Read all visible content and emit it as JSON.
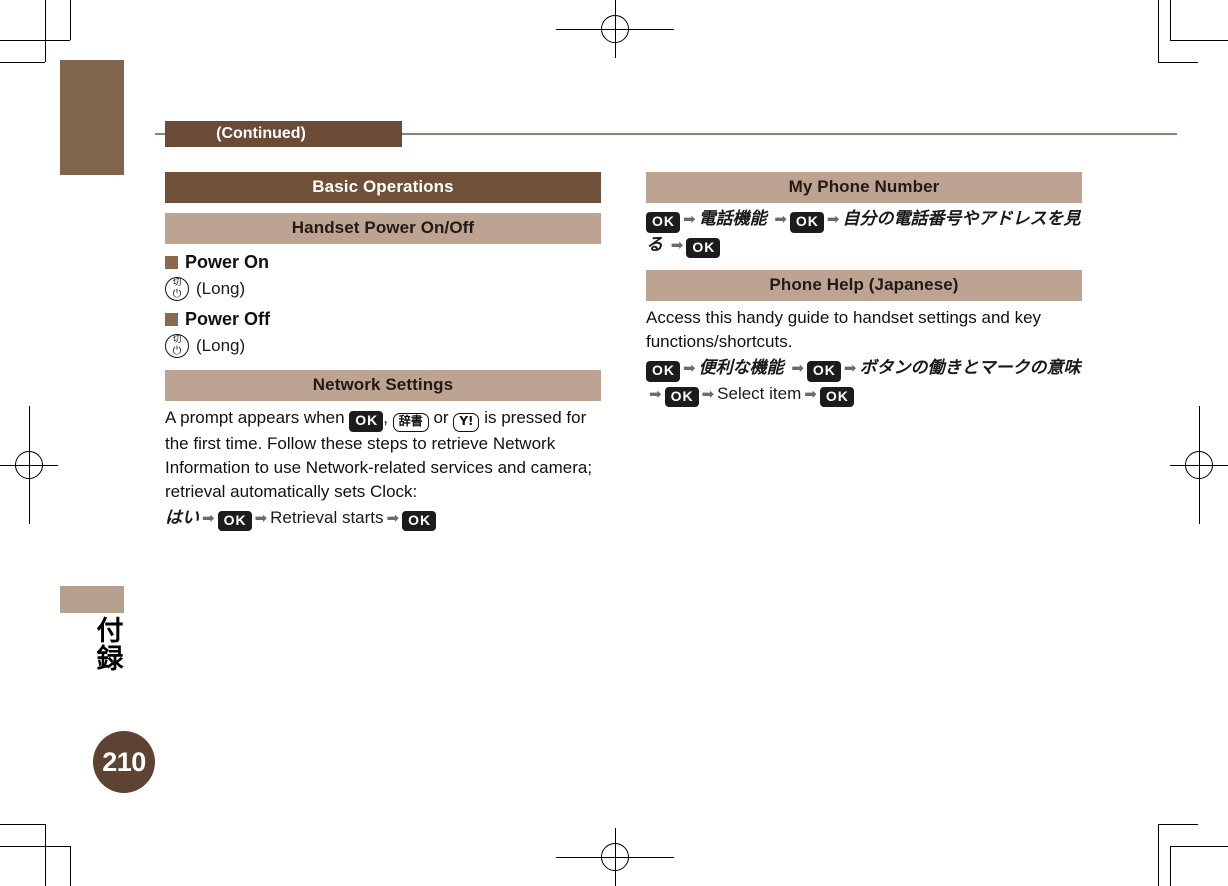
{
  "page": {
    "continued_label": "(Continued)",
    "page_number": "210",
    "side_tab_label": "付録"
  },
  "colors": {
    "bar_major": "#6F5038",
    "bar_minor": "#BCA392",
    "tab": "#80644C",
    "page_badge": "#5E4232",
    "rule": "#9A7F6A"
  },
  "icons": {
    "ok_key": "OK",
    "dictionary_key": "辞書",
    "yahoo_key": "Y!",
    "power_key_top": "切",
    "power_key_bottom": "⏻",
    "arrow": "➡"
  },
  "left_column": {
    "section_title": "Basic Operations",
    "blocks": [
      {
        "heading": "Handset Power On/Off",
        "subsections": [
          {
            "label": "Power On",
            "action": "(Long)"
          },
          {
            "label": "Power Off",
            "action": "(Long)"
          }
        ]
      },
      {
        "heading": "Network Settings",
        "body_part_1": "A prompt appears when ",
        "body_part_2": ", ",
        "body_part_3": " or ",
        "body_part_4": " is pressed for the first time. Follow these steps to retrieve Network Information to use Network-related services and camera; retrieval automatically sets Clock:",
        "steps": {
          "s1": "はい",
          "s2": "OK",
          "s3": "Retrieval starts",
          "s4": "OK"
        }
      }
    ]
  },
  "right_column": {
    "blocks": [
      {
        "heading": "My Phone Number",
        "steps": {
          "s1": "OK",
          "s2": "電話機能",
          "s3": "OK",
          "s4": "自分の電話番号やアドレスを見る",
          "s5": "OK"
        }
      },
      {
        "heading": "Phone Help (Japanese)",
        "body": "Access this handy guide to handset settings and key functions/shortcuts.",
        "steps": {
          "s1": "OK",
          "s2": "便利な機能",
          "s3": "OK",
          "s4": "ボタンの働きとマークの意味",
          "s5": "OK",
          "s6": "Select item",
          "s7": "OK"
        }
      }
    ]
  }
}
